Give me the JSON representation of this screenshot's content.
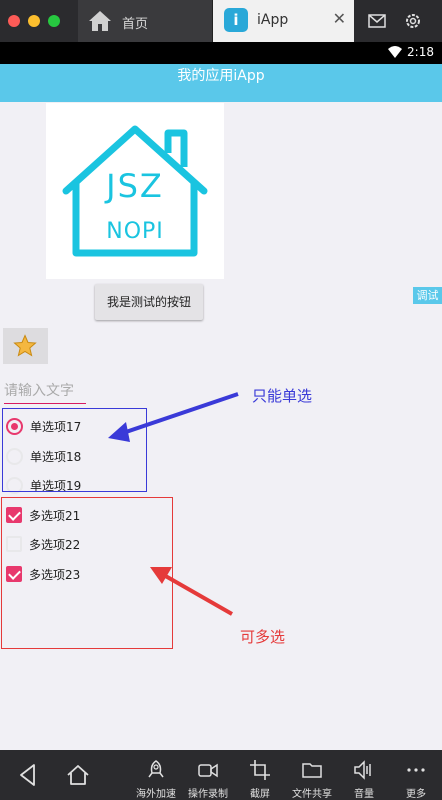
{
  "emulator": {
    "home_tab_label": "首页",
    "app_tab_label": "iApp",
    "app_tab_icon_letter": "i",
    "close_glyph": "✕"
  },
  "status_bar": {
    "time": "2:18"
  },
  "app": {
    "title": "我的应用iApp",
    "logo": {
      "line1": "JSZ",
      "line2": "NOPI",
      "color": "#1ac4e0"
    },
    "test_button_label": "我是测试的按钮",
    "debug_button_label": "调试",
    "input_placeholder": "请输入文字",
    "radios": [
      {
        "label": "单选项17",
        "checked": true
      },
      {
        "label": "单选项18",
        "checked": false
      },
      {
        "label": "单选项19",
        "checked": false
      }
    ],
    "checkboxes": [
      {
        "label": "多选项21",
        "checked": true
      },
      {
        "label": "多选项22",
        "checked": false
      },
      {
        "label": "多选项23",
        "checked": true
      }
    ]
  },
  "annotations": {
    "single_select": "只能单选",
    "multi_select": "可多选",
    "blue": "#3a3ad8",
    "red": "#e53a3a"
  },
  "toolbar": {
    "items": [
      {
        "icon": "rocket-icon",
        "label": "海外加速"
      },
      {
        "icon": "video-icon",
        "label": "操作录制"
      },
      {
        "icon": "crop-icon",
        "label": "截屏"
      },
      {
        "icon": "folder-icon",
        "label": "文件共享"
      },
      {
        "icon": "volume-icon",
        "label": "音量"
      },
      {
        "icon": "more-icon",
        "label": "更多"
      }
    ]
  },
  "colors": {
    "accent": "#5ac8ea",
    "checked": "#e8386d"
  }
}
